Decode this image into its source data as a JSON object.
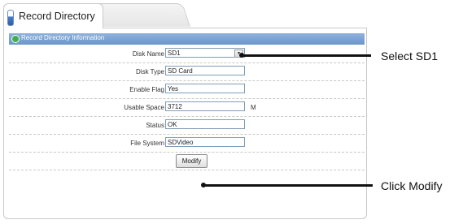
{
  "tab": {
    "label": "Record Directory"
  },
  "section": {
    "title": "Record Directory Information"
  },
  "fields": {
    "disk_name": {
      "label": "Disk Name",
      "value": "SD1"
    },
    "disk_type": {
      "label": "Disk Type",
      "value": "SD Card"
    },
    "enable_flag": {
      "label": "Enable Flag",
      "value": "Yes"
    },
    "usable_space": {
      "label": "Usable Space",
      "value": "3712",
      "unit": "M"
    },
    "status": {
      "label": "Status",
      "value": "OK"
    },
    "file_system": {
      "label": "File System",
      "value": "SDVideo"
    }
  },
  "buttons": {
    "modify": "Modify"
  },
  "callouts": {
    "select": "Select SD1",
    "modify": "Click Modify"
  }
}
